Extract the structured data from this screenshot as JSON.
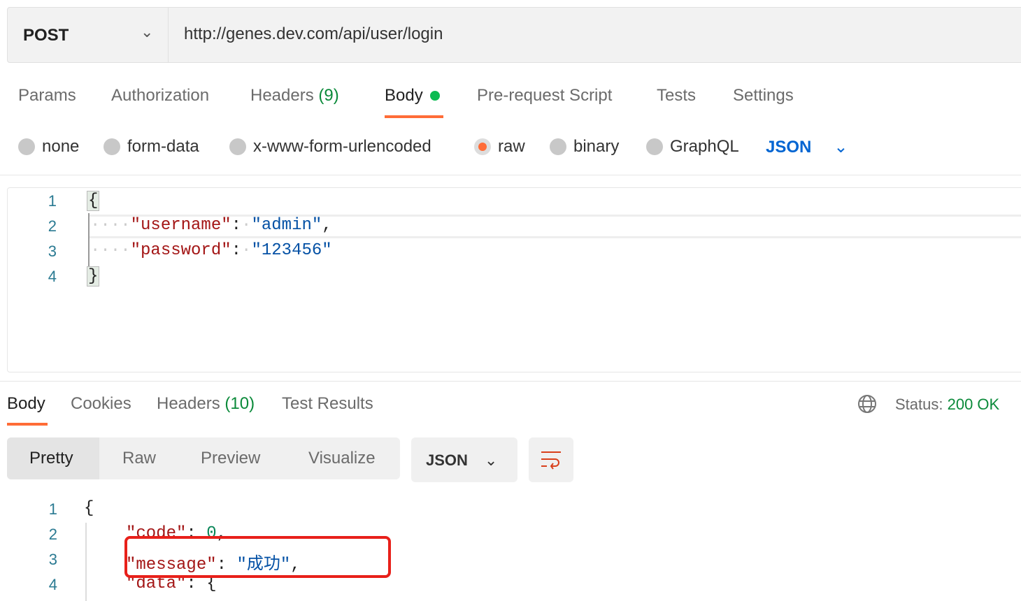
{
  "request": {
    "method": "POST",
    "url": "http://genes.dev.com/api/user/login"
  },
  "req_tabs": [
    {
      "label": "Params"
    },
    {
      "label": "Authorization"
    },
    {
      "label": "Headers",
      "count": "(9)"
    },
    {
      "label": "Body",
      "active": true
    },
    {
      "label": "Pre-request Script"
    },
    {
      "label": "Tests"
    },
    {
      "label": "Settings"
    }
  ],
  "body_types": [
    "none",
    "form-data",
    "x-www-form-urlencoded",
    "raw",
    "binary",
    "GraphQL"
  ],
  "body_selected": "raw",
  "body_format": "JSON",
  "request_body": {
    "lines": [
      "1",
      "2",
      "3",
      "4"
    ],
    "open": "{",
    "close": "}",
    "k1": "\"username\"",
    "v1": "\"admin\"",
    "k2": "\"password\"",
    "v2": "\"123456\""
  },
  "resp_tabs": [
    {
      "label": "Body",
      "active": true
    },
    {
      "label": "Cookies"
    },
    {
      "label": "Headers",
      "count": "(10)"
    },
    {
      "label": "Test Results"
    }
  ],
  "status": {
    "label": "Status:",
    "value": "200 OK"
  },
  "view_modes": [
    "Pretty",
    "Raw",
    "Preview",
    "Visualize"
  ],
  "resp_format": "JSON",
  "response_body": {
    "lines": [
      "1",
      "2",
      "3",
      "4"
    ],
    "open": "{",
    "k1": "\"code\"",
    "v1": "0",
    "k2": "\"message\"",
    "v2": "\"成功\"",
    "k3": "\"data\"",
    "v3": "{"
  },
  "colors": {
    "accent": "#ff6c37",
    "green": "#0b8a3a",
    "highlight": "#e8201a",
    "blue": "#0265d2"
  }
}
